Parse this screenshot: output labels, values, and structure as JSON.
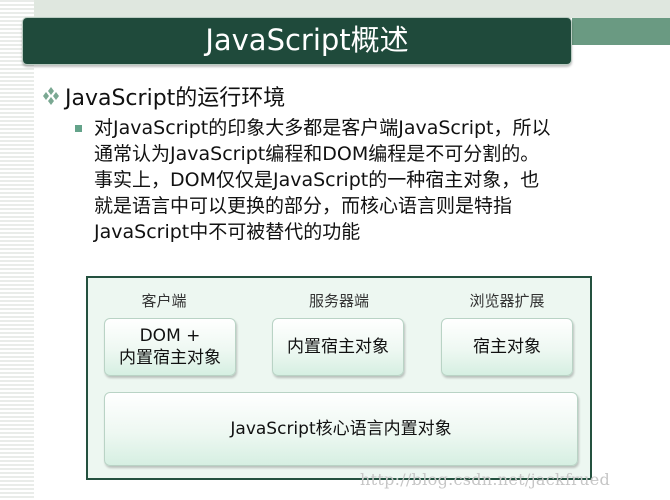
{
  "slide": {
    "title": "JavaScript概述",
    "bullet": "JavaScript的运行环境",
    "paragraph": "对JavaScript的印象大多都是客户端JavaScript，所以\n通常认为JavaScript编程和DOM编程是不可分割的。\n事实上，DOM仅仅是JavaScript的一种宿主对象，也\n就是语言中可以更换的部分，而核心语言则是特指\nJavaScript中不可被替代的功能"
  },
  "diagram": {
    "columns": [
      {
        "label": "客户端",
        "box": "DOM +\n内置宿主对象"
      },
      {
        "label": "服务器端",
        "box": "内置宿主对象"
      },
      {
        "label": "浏览器扩展",
        "box": "宿主对象"
      }
    ],
    "core": "JavaScript核心语言内置对象"
  },
  "watermark": "http://blog.csdn.net/jackfrued",
  "colors": {
    "title_bar": "#1f4a3b",
    "accent": "#6a9a82",
    "diagram_bg": "#edf7f1",
    "diagram_border": "#24513f",
    "bullet_square": "#64a38a"
  },
  "icons": {
    "bullet_level1": "diamond-cluster-icon",
    "bullet_level2": "square-bullet-icon"
  }
}
